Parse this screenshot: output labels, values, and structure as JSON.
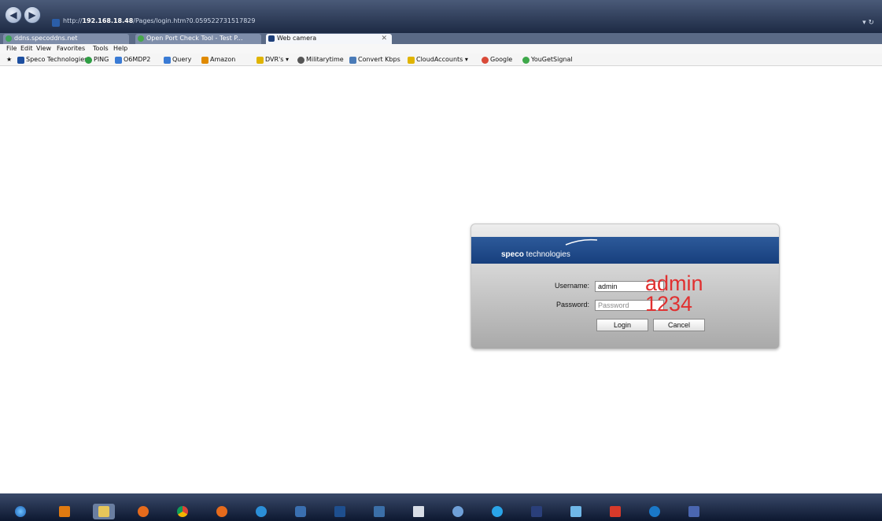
{
  "browser": {
    "address": {
      "scheme": "http://",
      "host": "192.168.18.48",
      "path": "/Pages/login.htm?0.059522731517829"
    },
    "tabs": [
      {
        "label": "ddns.specoddns.net"
      },
      {
        "label": "Open Port Check Tool - Test P..."
      },
      {
        "label": "Web camera"
      }
    ],
    "menu": [
      "File",
      "Edit",
      "View",
      "Favorites",
      "Tools",
      "Help"
    ],
    "favorites": [
      {
        "label": "Speco Technologies",
        "color": "#1d4fa0"
      },
      {
        "label": "PING",
        "color": "#2f9e44"
      },
      {
        "label": "O6MDP2",
        "color": "#3a7bd5"
      },
      {
        "label": "Query",
        "color": "#3a7bd5"
      },
      {
        "label": "Amazon",
        "color": "#e08a00"
      },
      {
        "label": "DVR's ▾",
        "color": "#e0b400"
      },
      {
        "label": "Militarytime",
        "color": "#555555"
      },
      {
        "label": "Convert Kbps",
        "color": "#4a7bb8"
      },
      {
        "label": "CloudAccounts ▾",
        "color": "#e0b400"
      },
      {
        "label": "Google",
        "color": "#d94a38"
      },
      {
        "label": "YouGetSignal",
        "color": "#3ea84a"
      }
    ]
  },
  "login": {
    "brand_bold": "speco",
    "brand_rest": " technologies",
    "username_label": "Username:",
    "username_value": "admin",
    "password_label": "Password:",
    "password_placeholder": "Password",
    "annotation_username": "admin",
    "annotation_password": "1234",
    "login_button": "Login",
    "cancel_button": "Cancel"
  },
  "taskbar": {
    "icons": [
      "start-orb",
      "media",
      "explorer",
      "firefox",
      "chrome",
      "firefox-alt",
      "internet-explorer",
      "app",
      "speco-board",
      "speco-viewer",
      "window",
      "globe",
      "skype",
      "cmd-app",
      "app-k",
      "media-red",
      "teamviewer",
      "app-puzzle"
    ]
  }
}
